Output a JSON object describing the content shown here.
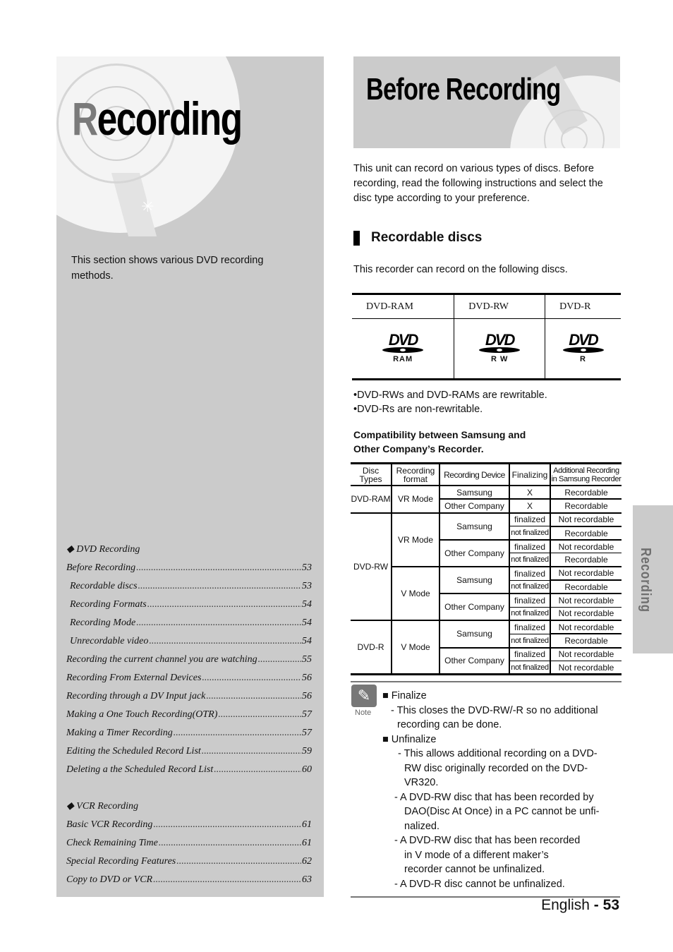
{
  "left_panel": {
    "title_first_letter": "R",
    "title_rest": "ecording",
    "intro": "This section shows various DVD recording methods.",
    "toc_sections": [
      {
        "heading": "◆ DVD Recording",
        "items": [
          {
            "title": "Before Recording",
            "page": "53",
            "indent": false
          },
          {
            "title": "Recordable discs",
            "page": "53",
            "indent": true
          },
          {
            "title": "Recording Formats",
            "page": "54",
            "indent": true
          },
          {
            "title": "Recording Mode",
            "page": "54",
            "indent": true
          },
          {
            "title": "Unrecordable video",
            "page": "54",
            "indent": true
          },
          {
            "title": "Recording the current channel you are watching",
            "page": "55",
            "indent": false
          },
          {
            "title": "Recording From External Devices",
            "page": "56",
            "indent": false
          },
          {
            "title": "Recording through a DV Input jack",
            "page": "56",
            "indent": false
          },
          {
            "title": "Making a One Touch Recording(OTR)",
            "page": "57",
            "indent": false
          },
          {
            "title": "Making a Timer Recording",
            "page": "57",
            "indent": false
          },
          {
            "title": "Editing the Scheduled Record List",
            "page": "59",
            "indent": false
          },
          {
            "title": "Deleting a the Scheduled Record List",
            "page": "60",
            "indent": false
          }
        ]
      },
      {
        "heading": "◆ VCR Recording",
        "items": [
          {
            "title": "Basic VCR Recording",
            "page": "61",
            "indent": false
          },
          {
            "title": "Check Remaining Time",
            "page": "61",
            "indent": false
          },
          {
            "title": "Special Recording Features",
            "page": "62",
            "indent": false
          },
          {
            "title": "Copy to DVD or VCR",
            "page": "63",
            "indent": false
          }
        ]
      }
    ]
  },
  "right": {
    "title": "Before Recording",
    "intro": "This unit can record on various types of discs. Before recording, read the following instructions and select the disc type according to your preference.",
    "section_heading": "Recordable discs",
    "section_intro": "This recorder can record on the following discs.",
    "disc_table": {
      "headers": [
        "DVD-RAM",
        "DVD-RW",
        "DVD-R"
      ],
      "logos": [
        {
          "icon": "dvd-ram-logo-icon",
          "word": "DVD",
          "sub": "RAM"
        },
        {
          "icon": "dvd-rw-logo-icon",
          "word": "DVD",
          "sub": "R W"
        },
        {
          "icon": "dvd-r-logo-icon",
          "word": "DVD",
          "sub": "R"
        }
      ]
    },
    "bullets": [
      "•DVD-RWs and DVD-RAMs are rewritable.",
      "•DVD-Rs are non-rewritable."
    ],
    "compat_title_line1": "Compatibility between Samsung and",
    "compat_title_line2": "Other Company’s Recorder.",
    "compat_table": {
      "headers": {
        "disc_types": "Disc Types",
        "format_1": "Recording",
        "format_2": "format",
        "device": "Recording Device",
        "finalizing": "Finalizing",
        "additional_1": "Additional Recording",
        "additional_2": "in Samsung Recorder"
      },
      "ram": {
        "disc": "DVD-RAM",
        "format": "VR Mode",
        "rows": [
          {
            "device": "Samsung",
            "finalizing": "X",
            "result": "Recordable"
          },
          {
            "device": "Other Company",
            "finalizing": "X",
            "result": "Recordable"
          }
        ]
      },
      "rw": {
        "disc": "DVD-RW",
        "vr_format": "VR Mode",
        "v_format": "V Mode",
        "vr_samsung": "Samsung",
        "vr_other": "Other Company",
        "v_samsung": "Samsung",
        "v_other": "Other Company",
        "rows": [
          {
            "finalizing": "finalized",
            "result": "Not recordable"
          },
          {
            "finalizing": "not finalized",
            "result": "Recordable"
          },
          {
            "finalizing": "finalized",
            "result": "Not recordable"
          },
          {
            "finalizing": "not finalized",
            "result": "Recordable"
          },
          {
            "finalizing": "finalized",
            "result": "Not recordable"
          },
          {
            "finalizing": "not finalized",
            "result": "Recordable"
          },
          {
            "finalizing": "finalized",
            "result": "Not recordable"
          },
          {
            "finalizing": "not finalized",
            "result": "Not recordable"
          }
        ]
      },
      "r": {
        "disc": "DVD-R",
        "format": "V Mode",
        "samsung": "Samsung",
        "other": "Other Company",
        "rows": [
          {
            "finalizing": "finalized",
            "result": "Not recordable"
          },
          {
            "finalizing": "not finalized",
            "result": "Recordable"
          },
          {
            "finalizing": "finalized",
            "result": "Not recordable"
          },
          {
            "finalizing": "not finalized",
            "result": "Not recordable"
          }
        ]
      }
    },
    "note": {
      "label": "Note",
      "icon": "pencil-note-icon",
      "finalize_head": "■ Finalize",
      "finalize_1": "- This closes the DVD-RW/-R so no additional",
      "finalize_2": "recording can be done.",
      "unfinalize_head": "■ Unfinalize",
      "u1_1": "- This allows additional recording on a DVD-",
      "u1_2": "RW disc originally recorded on the DVD-",
      "u1_3": "VR320.",
      "u2_1": "-  A DVD-RW disc that has been recorded by",
      "u2_2": "DAO(Disc At Once) in a PC cannot be unfi-",
      "u2_3": "nalized.",
      "u3_1": "-  A DVD-RW disc that has been recorded",
      "u3_2": "in V mode of a different maker’s",
      "u3_3": "recorder cannot be unfinalized.",
      "u4_1": "-  A DVD-R disc cannot be unfinalized."
    }
  },
  "footer": {
    "language": "English",
    "separator": " - ",
    "page": "53"
  },
  "side_tab": {
    "label": "Recording"
  }
}
